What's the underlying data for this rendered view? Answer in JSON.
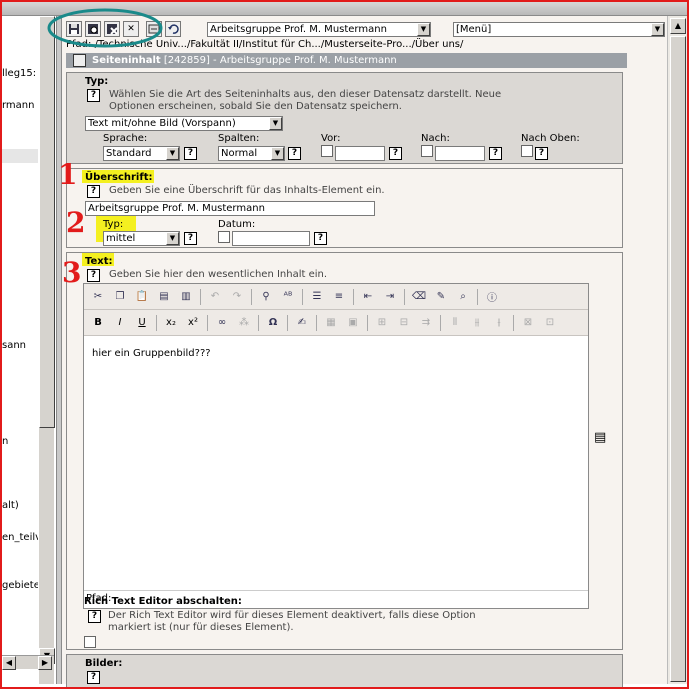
{
  "left_tree": {
    "items": [
      "lleg15:",
      "rmann",
      "sann",
      "n",
      "alt)",
      "en_teilv",
      "gebiete"
    ]
  },
  "toolbar": {
    "icons": [
      "save-icon",
      "save-view-icon",
      "save-close-icon",
      "close-icon",
      "undo-history-icon",
      "undo-icon"
    ],
    "page_select": "Arbeitsgruppe Prof. M. Mustermann",
    "menu_select": "[Menü]"
  },
  "path": "Pfad: /Technische Univ.../Fakultät II/Institut für Ch.../Musterseite-Pro.../Über uns/",
  "header": {
    "title": "Seiteninhalt",
    "rest": "[242859] - Arbeitsgruppe Prof. M. Mustermann"
  },
  "typ_section": {
    "label": "Typ:",
    "help_line1": "Wählen Sie die Art des Seiteninhalts aus, den dieser Datensatz darstellt. Neue",
    "help_line2": "Optionen erscheinen, sobald Sie den Datensatz speichern.",
    "type_value": "Text mit/ohne Bild (Vorspann)",
    "sprache_label": "Sprache:",
    "sprache_value": "Standard",
    "spalten_label": "Spalten:",
    "spalten_value": "Normal",
    "vor_label": "Vor:",
    "nach_label": "Nach:",
    "nach_oben_label": "Nach Oben:"
  },
  "header_section": {
    "label": "Überschrift:",
    "help": "Geben Sie eine Überschrift für das Inhalts-Element ein.",
    "value": "Arbeitsgruppe Prof. M. Mustermann",
    "typ_label": "Typ:",
    "typ_value": "mittel",
    "datum_label": "Datum:"
  },
  "text_section": {
    "label": "Text:",
    "help": "Geben Sie hier den wesentlichen Inhalt ein.",
    "content": "hier ein Gruppenbild???",
    "path_label": "Pfad:"
  },
  "rte_toggle": {
    "label": "Rich Text Editor abschalten:",
    "help_line1": "Der Rich Text Editor wird für dieses Element deaktivert, falls diese Option",
    "help_line2": "markiert ist (nur für dieses Element)."
  },
  "bilder_section": {
    "label": "Bilder:"
  },
  "annotations": [
    "1",
    "2",
    "3"
  ],
  "colors": {
    "annotation": "#e21b1b",
    "highlight": "#f4f020",
    "circle": "#1a8a8a"
  }
}
